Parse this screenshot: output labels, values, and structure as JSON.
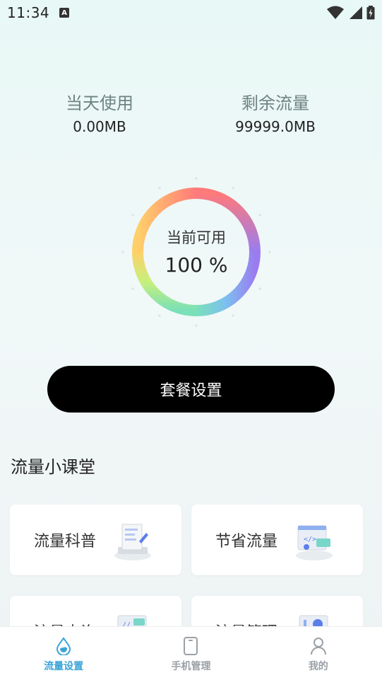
{
  "status_bar": {
    "time": "11:34",
    "a_badge": "A"
  },
  "stats": {
    "today_label": "当天使用",
    "today_value": "0.00MB",
    "remaining_label": "剩余流量",
    "remaining_value": "99999.0MB"
  },
  "gauge": {
    "title": "当前可用",
    "value_text": "100 %",
    "percent": 100
  },
  "plan_button": {
    "label": "套餐设置"
  },
  "section": {
    "title": "流量小课堂"
  },
  "cards": [
    {
      "label": "流量科普",
      "icon": "document-icon"
    },
    {
      "label": "节省流量",
      "icon": "code-window-icon"
    },
    {
      "label": "流量查询",
      "icon": "search-doc-icon"
    },
    {
      "label": "流量管理",
      "icon": "chart-doc-icon"
    }
  ],
  "bottom_nav": [
    {
      "label": "流量设置",
      "icon": "drop-icon",
      "active": true
    },
    {
      "label": "手机管理",
      "icon": "phone-icon",
      "active": false
    },
    {
      "label": "我的",
      "icon": "person-icon",
      "active": false
    }
  ],
  "colors": {
    "active": "#3aa4d8",
    "inactive": "#9aa0a6",
    "button": "#000000"
  }
}
